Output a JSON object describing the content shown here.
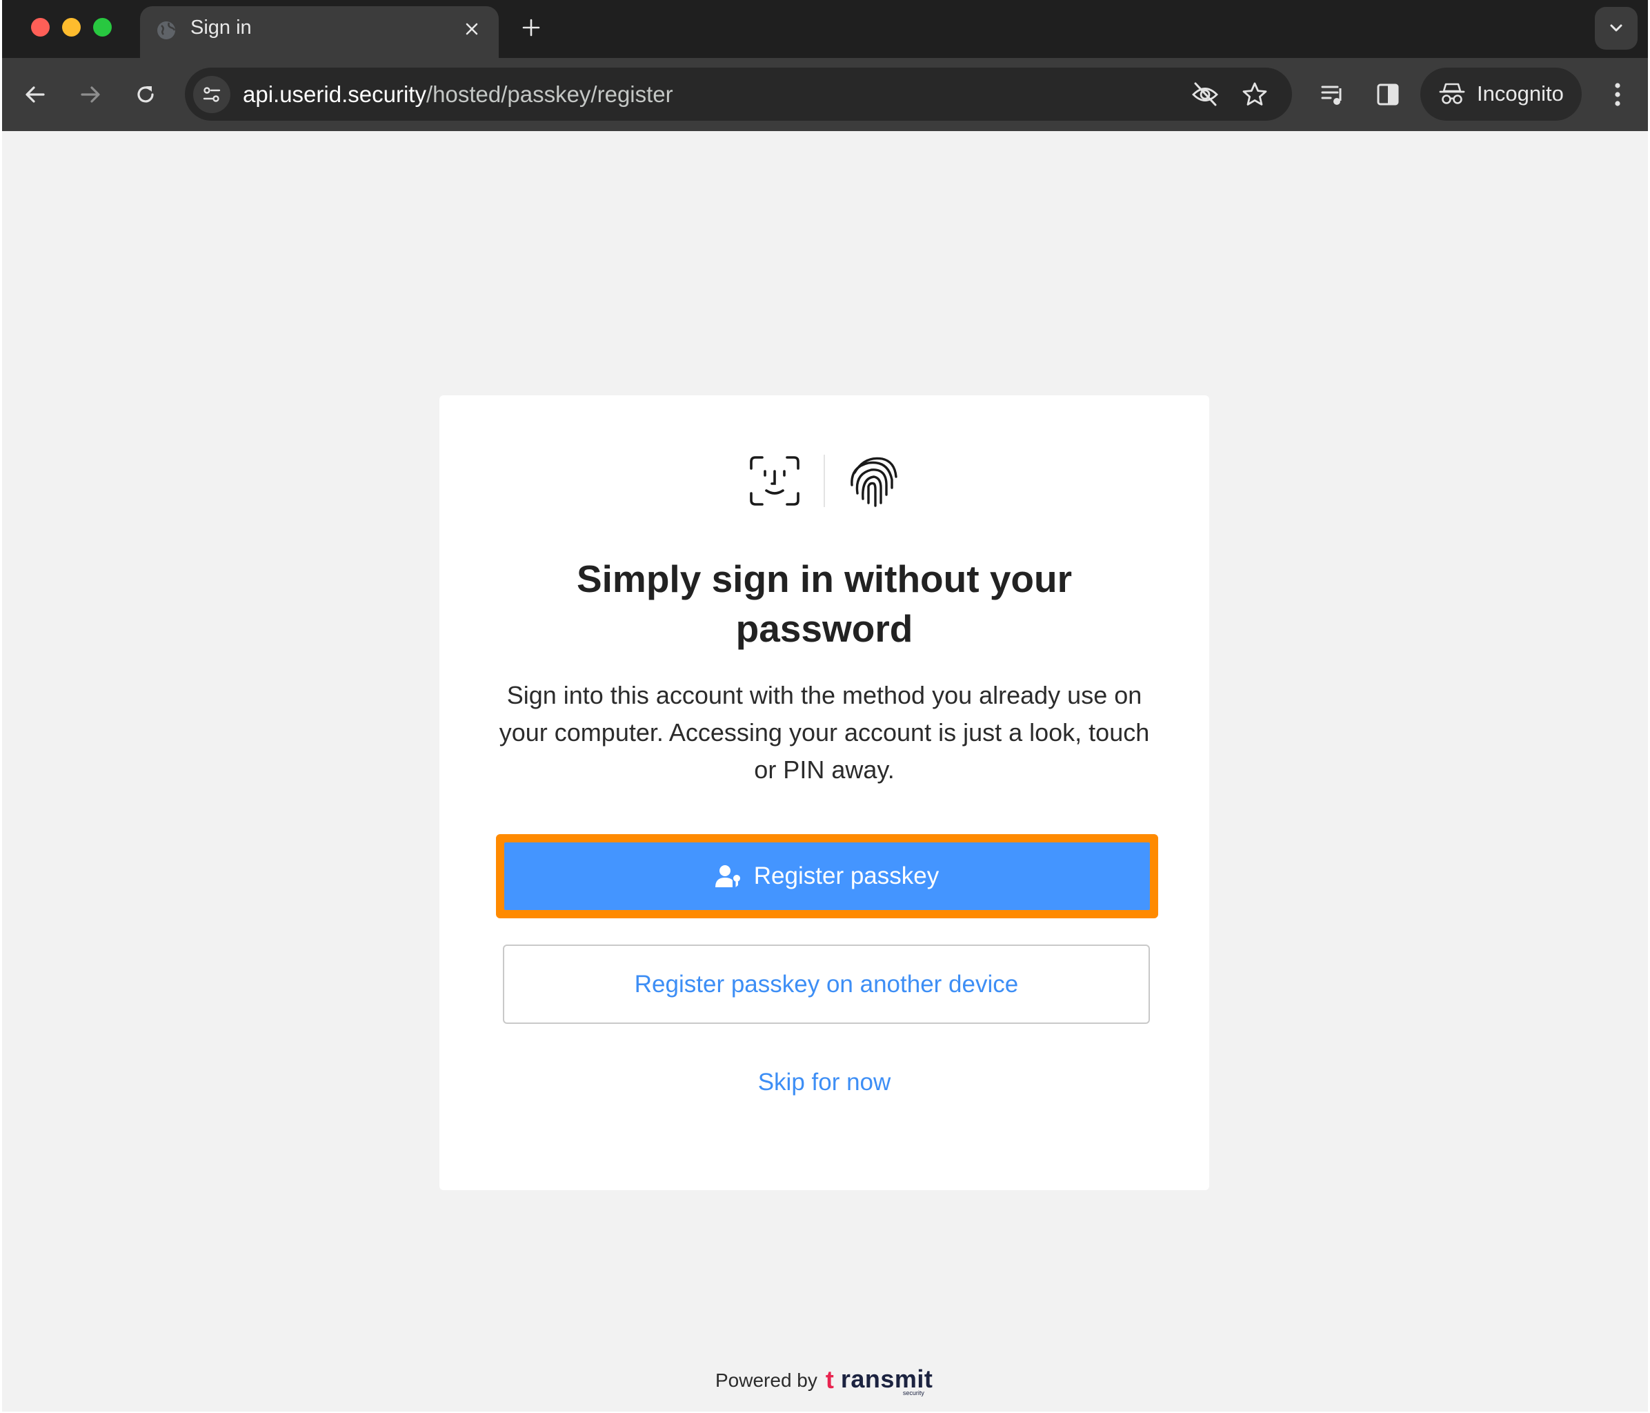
{
  "browser": {
    "tab": {
      "title": "Sign in",
      "close_icon": "close-icon",
      "favicon": "globe-icon"
    },
    "new_tab_icon": "plus-icon",
    "tab_search_icon": "chevron-down-icon",
    "nav": {
      "back_icon": "arrow-left-icon",
      "forward_icon": "arrow-right-icon",
      "reload_icon": "reload-icon"
    },
    "omnibox": {
      "site_info_icon": "tune-icon",
      "url_host": "api.userid.security",
      "url_path": "/hosted/passkey/register",
      "eye_off_icon": "eye-off-icon",
      "bookmark_icon": "star-icon"
    },
    "toolbar": {
      "reading_list_icon": "playlist-icon",
      "side_panel_icon": "side-panel-icon",
      "menu_icon": "kebab-icon"
    },
    "incognito": {
      "label": "Incognito",
      "icon": "incognito-icon"
    }
  },
  "page": {
    "icons": [
      "face-id-icon",
      "fingerprint-icon"
    ],
    "headline": "Simply sign in without your password",
    "description": "Sign into this account with the method you already use on your computer. Accessing your account is just a look, touch or PIN away.",
    "primary_button": {
      "label": "Register passkey",
      "icon": "user-key-icon"
    },
    "secondary_button": {
      "label": "Register passkey on another device"
    },
    "skip_link": "Skip for now",
    "footer": {
      "powered_by": "Powered by",
      "brand_t": "t",
      "brand_rest": "ransmit",
      "brand_sub": "security"
    }
  },
  "colors": {
    "primary": "#4495ff",
    "highlight_border": "#ff8a00",
    "link": "#3d8ef5",
    "chrome_dark": "#1f1f1f",
    "chrome_toolbar": "#3c3c3c"
  }
}
